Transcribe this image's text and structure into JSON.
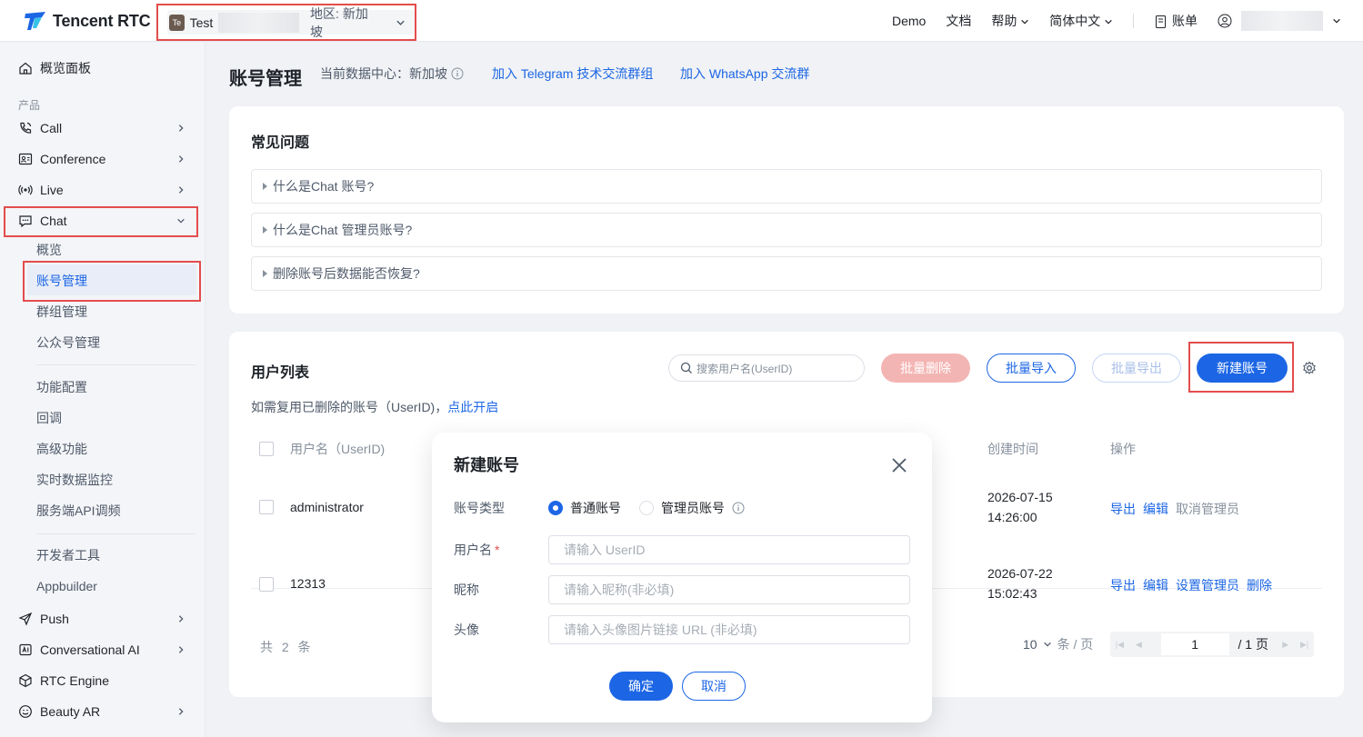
{
  "header": {
    "brand": "Tencent RTC",
    "app": {
      "avatar": "Te",
      "name": "Test",
      "region": "地区: 新加坡"
    },
    "links": {
      "demo": "Demo",
      "docs": "文档",
      "help": "帮助",
      "language": "简体中文",
      "billing": "账单"
    }
  },
  "sidebar": {
    "overview": "概览面板",
    "section_products": "产品",
    "items": {
      "call": "Call",
      "conference": "Conference",
      "live": "Live",
      "chat": "Chat",
      "push": "Push",
      "conversational_ai": "Conversational AI",
      "rtc_engine": "RTC Engine",
      "beauty_ar": "Beauty AR"
    },
    "chat_sub": {
      "overview": "概览",
      "accounts": "账号管理",
      "groups": "群组管理",
      "official": "公众号管理",
      "features": "功能配置",
      "callback": "回调",
      "advanced": "高级功能",
      "monitor": "实时数据监控",
      "api_debug": "服务端API调频",
      "dev_tools": "开发者工具",
      "appbuilder": "Appbuilder"
    }
  },
  "page": {
    "title": "账号管理",
    "datacenter": "当前数据中心：新加坡",
    "link_telegram": "加入 Telegram 技术交流群组",
    "link_whatsapp": "加入 WhatsApp 交流群"
  },
  "faq": {
    "title": "常见问题",
    "items": [
      "什么是Chat 账号?",
      "什么是Chat 管理员账号?",
      "删除账号后数据能否恢复?"
    ]
  },
  "users": {
    "title": "用户列表",
    "search_placeholder": "搜索用户名(UserID)",
    "btn_batch_delete": "批量删除",
    "btn_batch_import": "批量导入",
    "btn_batch_export": "批量导出",
    "btn_new": "新建账号",
    "hint": "如需复用已删除的账号（UserID)，",
    "hint_link": "点此开启",
    "columns": {
      "user": "用户名（UserID)",
      "created": "创建时间",
      "ops": "操作"
    },
    "rows": [
      {
        "user": "administrator",
        "created_date": "2026-07-15",
        "created_time": "14:26:00",
        "op1": "导出",
        "op2": "编辑",
        "op3": "取消管理员"
      },
      {
        "user": "12313",
        "created_date": "2026-07-22",
        "created_time": "15:02:43",
        "op1": "导出",
        "op2": "编辑",
        "op3": "设置管理员",
        "op4": "删除"
      }
    ],
    "total": "共 2 条",
    "page_size": "10",
    "page_size_unit": "条 / 页",
    "page_current": "1",
    "page_total": "/ 1 页"
  },
  "modal": {
    "title": "新建账号",
    "label_type": "账号类型",
    "radio_normal": "普通账号",
    "radio_admin": "管理员账号",
    "label_user": "用户名",
    "user_placeholder": "请输入 UserID",
    "label_nick": "昵称",
    "nick_placeholder": "请输入昵称(非必填)",
    "label_avatar": "头像",
    "avatar_placeholder": "请输入头像图片链接 URL (非必填)",
    "btn_ok": "确定",
    "btn_cancel": "取消"
  },
  "colors": {
    "primary": "#1c66e5",
    "highlight": "#e34d4d",
    "danger_light": "#f3b5b3"
  }
}
